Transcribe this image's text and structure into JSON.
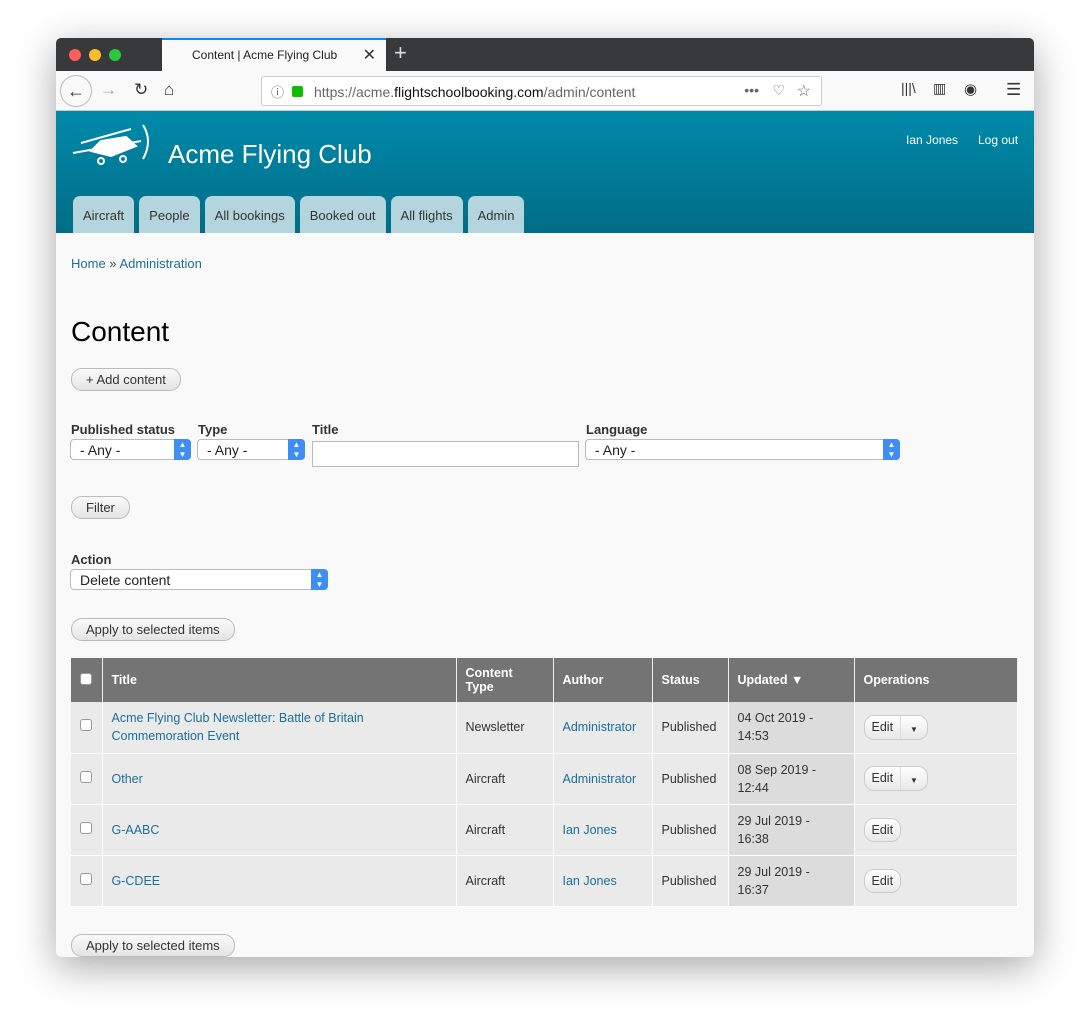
{
  "browser": {
    "tab_title": "Content | Acme Flying Club",
    "url_prefix": "https://acme.",
    "url_domain": "flightschoolbooking.com",
    "url_path": "/admin/content"
  },
  "site": {
    "name": "Acme Flying Club",
    "user": "Ian Jones",
    "logout": "Log out",
    "brand_color": "#007f9c"
  },
  "nav": [
    "Aircraft",
    "People",
    "All bookings",
    "Booked out",
    "All flights",
    "Admin"
  ],
  "breadcrumb": {
    "home": "Home",
    "sep": " » ",
    "admin": "Administration"
  },
  "page": {
    "title": "Content",
    "add_content": "+ Add content"
  },
  "filters": {
    "published_label": "Published status",
    "published_value": "- Any -",
    "type_label": "Type",
    "type_value": "- Any -",
    "title_label": "Title",
    "title_value": "",
    "language_label": "Language",
    "language_value": "- Any -",
    "filter_button": "Filter"
  },
  "action": {
    "label": "Action",
    "value": "Delete content",
    "apply": "Apply to selected items"
  },
  "table": {
    "headers": [
      "Title",
      "Content Type",
      "Author",
      "Status",
      "Updated",
      "Operations"
    ],
    "sort_indicator": "▼",
    "rows": [
      {
        "title": "Acme Flying Club Newsletter: Battle of Britain Commemoration Event",
        "type": "Newsletter",
        "author": "Administrator",
        "status": "Published",
        "updated": "04 Oct 2019 - 14:53",
        "op": "Edit",
        "dropdown": true
      },
      {
        "title": "Other",
        "type": "Aircraft",
        "author": "Administrator",
        "status": "Published",
        "updated": "08 Sep 2019 - 12:44",
        "op": "Edit",
        "dropdown": true
      },
      {
        "title": "G-AABC",
        "type": "Aircraft",
        "author": "Ian Jones",
        "status": "Published",
        "updated": "29 Jul 2019 - 16:38",
        "op": "Edit",
        "dropdown": false
      },
      {
        "title": "G-CDEE",
        "type": "Aircraft",
        "author": "Ian Jones",
        "status": "Published",
        "updated": "29 Jul 2019 - 16:37",
        "op": "Edit",
        "dropdown": false
      }
    ]
  }
}
